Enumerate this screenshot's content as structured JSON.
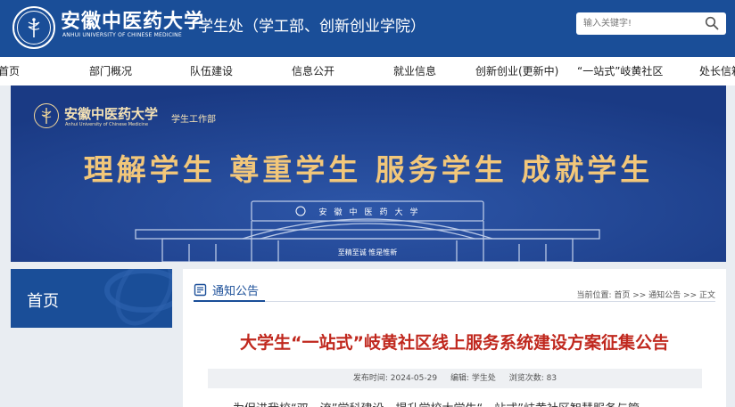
{
  "header": {
    "uni_name": "安徽中医药大学",
    "uni_en": "ANHUI UNIVERSITY OF CHINESE MEDICINE",
    "dept": "学生处（学工部、创新创业学院）",
    "search_placeholder": "输入关键字!",
    "search_icon": "search-icon"
  },
  "nav": {
    "items": [
      "首页",
      "部门概况",
      "队伍建设",
      "信息公开",
      "就业信息",
      "创新创业(更新中)",
      "“一站式”岐黄社区",
      "处长信箱"
    ]
  },
  "banner": {
    "uni_name": "安徽中医药大学",
    "uni_en": "Anhui University of Chinese Medicine",
    "dept": "学生工作部",
    "slogan": "理解学生  尊重学生  服务学生  成就学生",
    "gate_inscription": "安徽中医药大学",
    "gate_motto": "至精至诚  惟是惟新"
  },
  "sidebar": {
    "title": "首页"
  },
  "main": {
    "section_label": "通知公告",
    "breadcrumb": "当前位置: 首页 >> 通知公告 >> 正文",
    "article_title": "大学生“一站式”岐黄社区线上服务系统建设方案征集公告",
    "meta": {
      "publish_time": "发布时间: 2024-05-29",
      "editor": "编辑: 学生处",
      "views": "浏览次数: 83"
    },
    "body_first_line": "为促进我校“双一流”学科建设，提升学校大学生“一站式”岐黄社区智慧服务与管"
  },
  "colors": {
    "brand_blue": "#1a4e98",
    "banner_blue": "#1d3f8c",
    "slogan_gold": "#f2c77a",
    "title_red": "#c0281e"
  }
}
